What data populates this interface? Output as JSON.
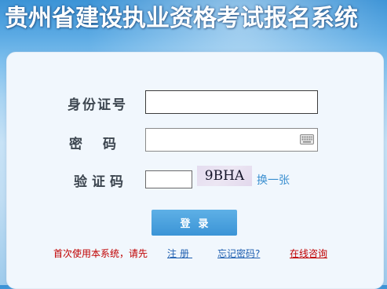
{
  "header": {
    "title": "贵州省建设执业资格考试报名系统"
  },
  "form": {
    "id_label": "身份证号",
    "id_value": "",
    "password_label_char1": "密",
    "password_label_char2": "码",
    "password_value": "",
    "captcha_label": "验证码",
    "captcha_input_value": "",
    "captcha_text": "9BHA",
    "refresh_label": "换一张",
    "login_label": "登录"
  },
  "footer": {
    "prompt": "首次使用本系统，请先",
    "register_label": "注册",
    "forgot_label": "忘记密码?",
    "consult_label": "在线咨询"
  },
  "icons": {
    "keyboard": "keyboard-icon"
  },
  "colors": {
    "accent": "#3b94d6",
    "link": "#1f5fb0",
    "alert": "#c00000"
  }
}
